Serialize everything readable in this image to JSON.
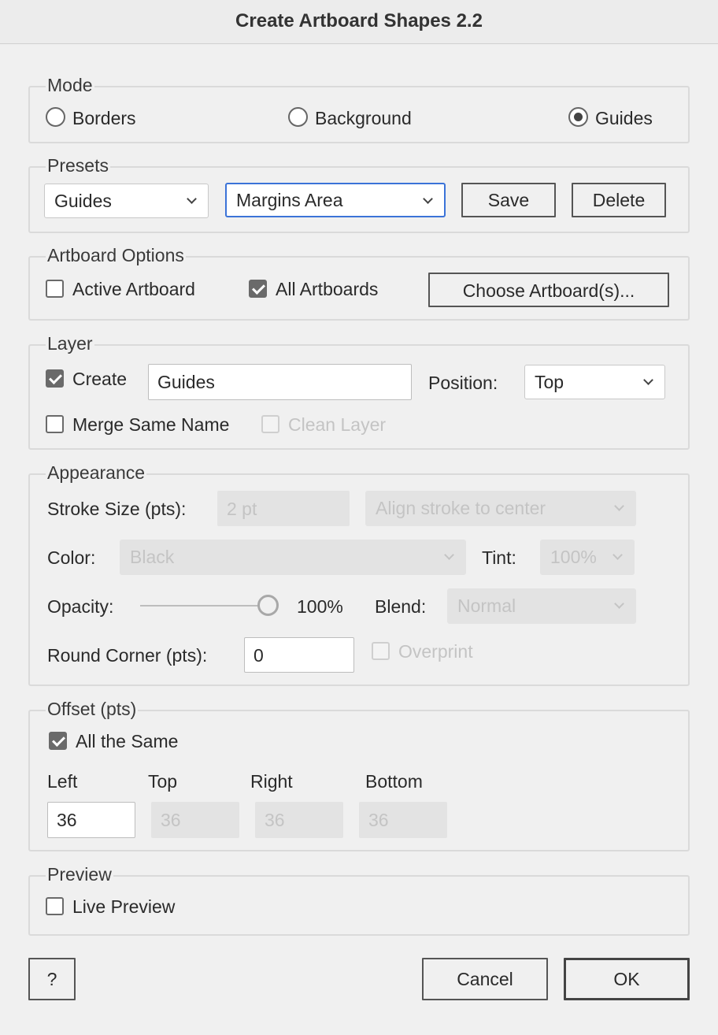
{
  "window": {
    "title": "Create Artboard Shapes 2.2"
  },
  "mode": {
    "legend": "Mode",
    "options": [
      {
        "label": "Borders",
        "selected": false
      },
      {
        "label": "Background",
        "selected": false
      },
      {
        "label": "Guides",
        "selected": true
      }
    ]
  },
  "presets": {
    "legend": "Presets",
    "category": "Guides",
    "preset": "Margins Area",
    "save_label": "Save",
    "delete_label": "Delete"
  },
  "artboard_options": {
    "legend": "Artboard Options",
    "active_label": "Active Artboard",
    "active_checked": false,
    "all_label": "All Artboards",
    "all_checked": true,
    "choose_label": "Choose Artboard(s)..."
  },
  "layer": {
    "legend": "Layer",
    "create_label": "Create",
    "create_checked": true,
    "name_value": "Guides",
    "position_label": "Position:",
    "position_value": "Top",
    "merge_label": "Merge Same Name",
    "merge_checked": false,
    "clean_label": "Clean Layer",
    "clean_checked": false
  },
  "appearance": {
    "legend": "Appearance",
    "stroke_label": "Stroke Size (pts):",
    "stroke_value": "2 pt",
    "align_value": "Align stroke to center",
    "color_label": "Color:",
    "color_value": "Black",
    "tint_label": "Tint:",
    "tint_value": "100%",
    "opacity_label": "Opacity:",
    "opacity_value": "100%",
    "opacity_fraction": 1.0,
    "blend_label": "Blend:",
    "blend_value": "Normal",
    "round_label": "Round Corner (pts):",
    "round_value": "0",
    "overprint_label": "Overprint",
    "overprint_checked": false
  },
  "offset": {
    "legend": "Offset (pts)",
    "same_label": "All the Same",
    "same_checked": true,
    "left_label": "Left",
    "top_label": "Top",
    "right_label": "Right",
    "bottom_label": "Bottom",
    "left_value": "36",
    "top_value": "36",
    "right_value": "36",
    "bottom_value": "36"
  },
  "preview": {
    "legend": "Preview",
    "live_label": "Live Preview",
    "live_checked": false
  },
  "footer": {
    "help_label": "?",
    "cancel_label": "Cancel",
    "ok_label": "OK"
  },
  "colors": {
    "focus_accent": "#3b73d8",
    "background": "#f0f0f0"
  }
}
